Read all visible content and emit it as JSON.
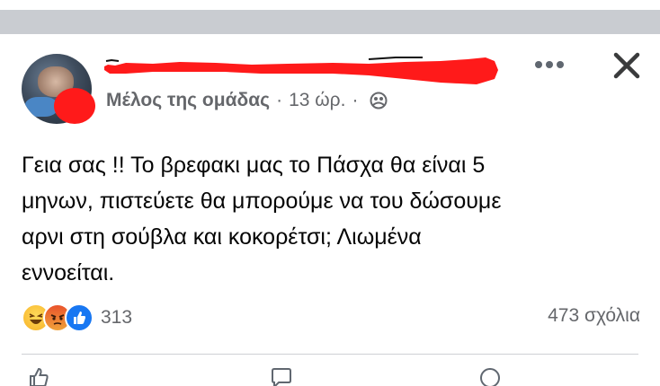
{
  "post": {
    "group_role": "Μέλος της ομάδας",
    "time": "13 ώρ.",
    "separator": "·",
    "audience_icon": "members-icon",
    "body_lines": [
      "Γεια σας !! Το βρεφακι μας το Πάσχα θα είναι 5",
      "μηνων, πιστεύετε θα μπορούμε να του δώσουμε",
      "αρνι στη σούβλα και κοκορέτσι; Λιωμένα",
      "εννοείται."
    ]
  },
  "stats": {
    "reaction_icons": [
      "haha-icon",
      "angry-icon",
      "like-icon"
    ],
    "reaction_count": "313",
    "comments": "473 σχόλια"
  },
  "colors": {
    "redaction": "#ff1a1a",
    "muted_text": "#65676b",
    "like_blue": "#1877f2",
    "top_band": "#c9ccd1"
  }
}
